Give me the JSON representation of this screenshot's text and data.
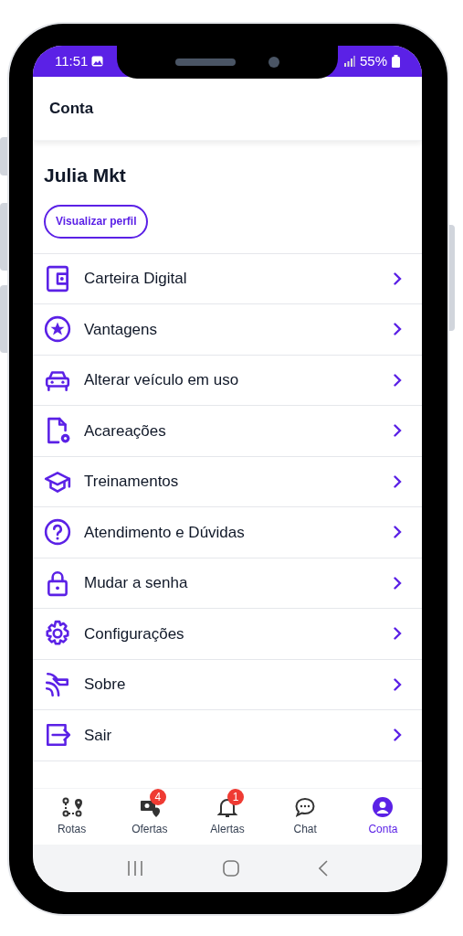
{
  "status_bar": {
    "time": "11:51",
    "battery": "55%"
  },
  "header": {
    "title": "Conta"
  },
  "profile": {
    "name": "Julia Mkt",
    "button": "Visualizar perfil"
  },
  "menu": [
    {
      "label": "Carteira Digital"
    },
    {
      "label": "Vantagens"
    },
    {
      "label": "Alterar veículo em uso"
    },
    {
      "label": "Acareações"
    },
    {
      "label": "Treinamentos"
    },
    {
      "label": "Atendimento e Dúvidas"
    },
    {
      "label": "Mudar a senha"
    },
    {
      "label": "Configurações"
    },
    {
      "label": "Sobre"
    },
    {
      "label": "Sair"
    }
  ],
  "bottom_nav": [
    {
      "label": "Rotas",
      "selected": false
    },
    {
      "label": "Ofertas",
      "selected": false,
      "badge": "4"
    },
    {
      "label": "Alertas",
      "selected": false,
      "badge": "1"
    },
    {
      "label": "Chat",
      "selected": false
    },
    {
      "label": "Conta",
      "selected": true
    }
  ]
}
